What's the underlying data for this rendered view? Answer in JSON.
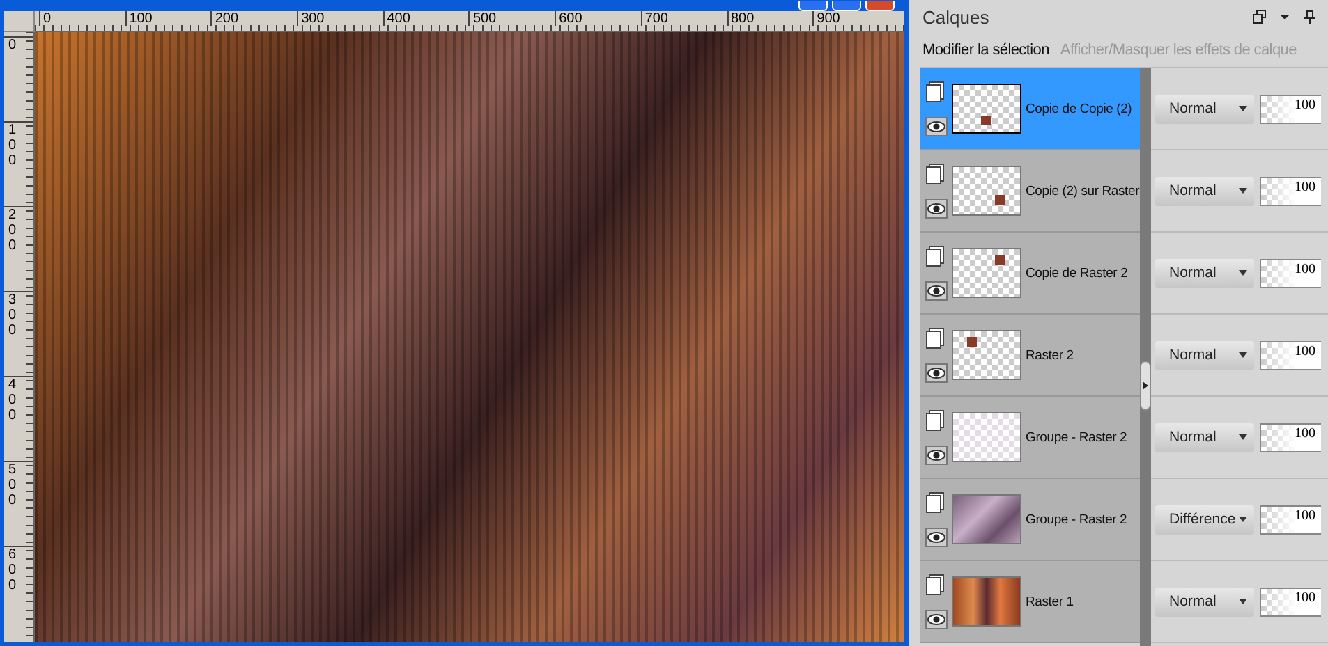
{
  "image_window": {
    "top_ruler": [
      "0",
      "100",
      "200",
      "300",
      "400",
      "500",
      "600",
      "700",
      "800",
      "900"
    ],
    "left_ruler": [
      "0",
      "100",
      "200",
      "300",
      "400",
      "500",
      "600"
    ]
  },
  "layers_panel": {
    "title": "Calques",
    "toolbar": [
      {
        "label": "Modifier la sélection",
        "disabled": false
      },
      {
        "label": "Afficher/Masquer les effets de calque",
        "disabled": true
      }
    ],
    "layers": [
      {
        "name": "Copie de Copie (2)",
        "blend_mode": "Normal",
        "opacity": "100",
        "selected": true,
        "kind": "transparent"
      },
      {
        "name": "Copie (2) sur Raster",
        "blend_mode": "Normal",
        "opacity": "100",
        "selected": false,
        "kind": "transparent"
      },
      {
        "name": "Copie de Raster 2",
        "blend_mode": "Normal",
        "opacity": "100",
        "selected": false,
        "kind": "transparent"
      },
      {
        "name": "Raster 2",
        "blend_mode": "Normal",
        "opacity": "100",
        "selected": false,
        "kind": "transparent"
      },
      {
        "name": "Groupe - Raster 2",
        "blend_mode": "Normal",
        "opacity": "100",
        "selected": false,
        "kind": "pattern"
      },
      {
        "name": "Groupe - Raster 2",
        "blend_mode": "Différence",
        "opacity": "100",
        "selected": false,
        "kind": "pattern-dark"
      },
      {
        "name": "Raster 1",
        "blend_mode": "Normal",
        "opacity": "100",
        "selected": false,
        "kind": "photo"
      }
    ]
  }
}
